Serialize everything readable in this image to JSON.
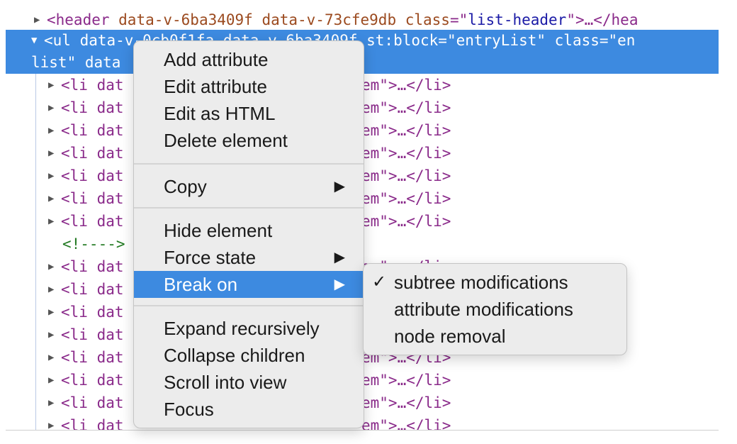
{
  "elements": {
    "header_line": {
      "tri": "▶",
      "open": "<header ",
      "attrs": "data-v-6ba3409f data-v-73cfe9db class",
      "eq": "=\"",
      "val": "list-header",
      "close": "\">…</hea"
    },
    "ul_line1": {
      "tri": "▼",
      "text": "<ul data-v-0cb0f1fa data-v-6ba3409f st:block=\"entryList\" class=\"en"
    },
    "ul_line2": {
      "text": "list\" data"
    },
    "li_left": "<li dat",
    "li_right": "em\">…</li>",
    "li_tri": "▶",
    "comment": "<!---->"
  },
  "context_menu": {
    "items": [
      {
        "label": "Add attribute"
      },
      {
        "label": "Edit attribute"
      },
      {
        "label": "Edit as HTML"
      },
      {
        "label": "Delete element"
      },
      {
        "label": "Copy",
        "arrow": "▶"
      },
      {
        "label": "Hide element"
      },
      {
        "label": "Force state",
        "arrow": "▶"
      },
      {
        "label": "Break on",
        "arrow": "▶",
        "active": true
      },
      {
        "label": "Expand recursively"
      },
      {
        "label": "Collapse children"
      },
      {
        "label": "Scroll into view"
      },
      {
        "label": "Focus"
      }
    ]
  },
  "submenu": {
    "items": [
      {
        "label": "subtree modifications",
        "check": "✓"
      },
      {
        "label": "attribute modifications",
        "check": ""
      },
      {
        "label": "node removal",
        "check": ""
      }
    ]
  },
  "colors": {
    "selection": "#3d8ae0",
    "tag": "#8a2a8a",
    "attr": "#9b4a1f",
    "value": "#1a1aa6",
    "comment": "#237a23"
  }
}
